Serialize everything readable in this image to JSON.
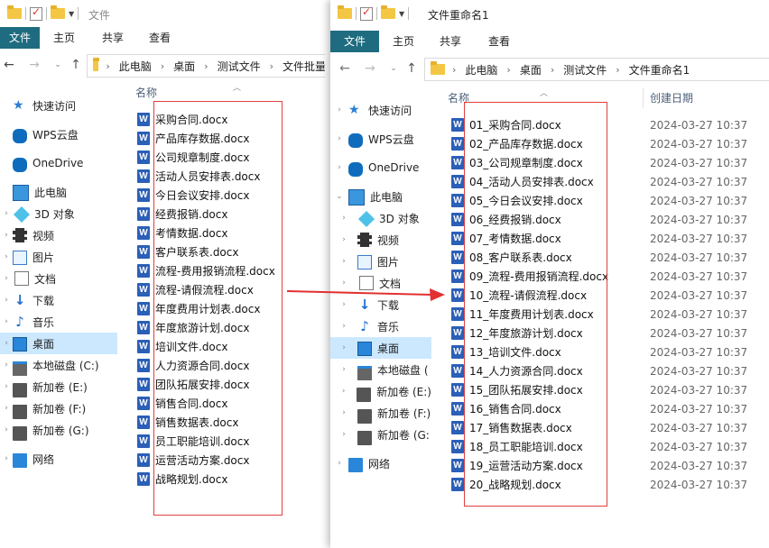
{
  "left": {
    "title": "文件",
    "ribbon": {
      "file": "文件",
      "home": "主页",
      "share": "共享",
      "view": "查看"
    },
    "breadcrumb": [
      "此电脑",
      "桌面",
      "测试文件",
      "文件批量"
    ],
    "col_name": "名称",
    "files": [
      "采购合同.docx",
      "产品库存数据.docx",
      "公司规章制度.docx",
      "活动人员安排表.docx",
      "今日会议安排.docx",
      "经费报销.docx",
      "考情数据.docx",
      "客户联系表.docx",
      "流程-费用报销流程.docx",
      "流程-请假流程.docx",
      "年度费用计划表.docx",
      "年度旅游计划.docx",
      "培训文件.docx",
      "人力资源合同.docx",
      "团队拓展安排.docx",
      "销售合同.docx",
      "销售数据表.docx",
      "员工职能培训.docx",
      "运营活动方案.docx",
      "战略规划.docx"
    ]
  },
  "right": {
    "title": "文件重命名1",
    "ribbon": {
      "file": "文件",
      "home": "主页",
      "share": "共享",
      "view": "查看"
    },
    "breadcrumb": [
      "此电脑",
      "桌面",
      "测试文件",
      "文件重命名1"
    ],
    "col_name": "名称",
    "col_date": "创建日期",
    "files": [
      "01_采购合同.docx",
      "02_产品库存数据.docx",
      "03_公司规章制度.docx",
      "04_活动人员安排表.docx",
      "05_今日会议安排.docx",
      "06_经费报销.docx",
      "07_考情数据.docx",
      "08_客户联系表.docx",
      "09_流程-费用报销流程.docx",
      "10_流程-请假流程.docx",
      "11_年度费用计划表.docx",
      "12_年度旅游计划.docx",
      "13_培训文件.docx",
      "14_人力资源合同.docx",
      "15_团队拓展安排.docx",
      "16_销售合同.docx",
      "17_销售数据表.docx",
      "18_员工职能培训.docx",
      "19_运营活动方案.docx",
      "20_战略规划.docx"
    ],
    "date": "2024-03-27 10:37"
  },
  "nav": {
    "quick_access": "快速访问",
    "wps_cloud": "WPS云盘",
    "onedrive": "OneDrive",
    "this_pc": "此电脑",
    "objects_3d": "3D 对象",
    "videos": "视频",
    "pictures": "图片",
    "documents": "文档",
    "downloads": "下载",
    "music": "音乐",
    "desktop": "桌面",
    "local_disk_left": "本地磁盘 (C:)",
    "local_disk_right": "本地磁盘 (",
    "vol_e": "新加卷 (E:)",
    "vol_f": "新加卷 (F:)",
    "vol_g": "新加卷 (G:)",
    "vol_g_right": "新加卷 (G:",
    "network": "网络"
  },
  "icons": {
    "file": "word-doc-icon",
    "accent": "#1f6c80",
    "highlight_box": "#e04040",
    "selected_nav": "#cce8ff"
  }
}
